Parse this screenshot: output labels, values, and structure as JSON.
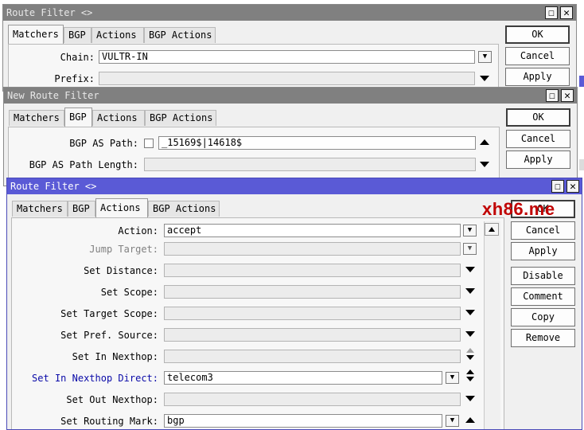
{
  "win1": {
    "title": "Route Filter <>",
    "tabs": [
      "Matchers",
      "BGP",
      "Actions",
      "BGP Actions"
    ],
    "chain_label": "Chain:",
    "chain_value": "VULTR-IN",
    "prefix_label": "Prefix:",
    "prefix_value": "",
    "buttons": {
      "ok": "OK",
      "cancel": "Cancel",
      "apply": "Apply"
    }
  },
  "win2": {
    "title": "New Route Filter",
    "tabs": [
      "Matchers",
      "BGP",
      "Actions",
      "BGP Actions"
    ],
    "as_path_label": "BGP AS Path:",
    "as_path_value": "_15169$|14618$",
    "as_path_length_label": "BGP AS Path Length:",
    "as_path_length_value": "",
    "buttons": {
      "ok": "OK",
      "cancel": "Cancel",
      "apply": "Apply"
    }
  },
  "win3": {
    "title": "Route Filter <>",
    "tabs": [
      "Matchers",
      "BGP",
      "Actions",
      "BGP Actions"
    ],
    "fields": {
      "action": {
        "label": "Action:",
        "value": "accept"
      },
      "jump_target": {
        "label": "Jump Target:",
        "value": ""
      },
      "set_distance": {
        "label": "Set Distance:",
        "value": ""
      },
      "set_scope": {
        "label": "Set Scope:",
        "value": ""
      },
      "set_target_scope": {
        "label": "Set Target Scope:",
        "value": ""
      },
      "set_pref_source": {
        "label": "Set Pref. Source:",
        "value": ""
      },
      "set_in_nexthop": {
        "label": "Set In Nexthop:",
        "value": ""
      },
      "set_in_nexthop_direct": {
        "label": "Set In Nexthop Direct:",
        "value": "telecom3"
      },
      "set_out_nexthop": {
        "label": "Set Out Nexthop:",
        "value": ""
      },
      "set_routing_mark": {
        "label": "Set Routing Mark:",
        "value": "bgp"
      }
    },
    "buttons": {
      "ok": "OK",
      "cancel": "Cancel",
      "apply": "Apply",
      "disable": "Disable",
      "comment": "Comment",
      "copy": "Copy",
      "remove": "Remove"
    }
  },
  "watermark": "xh86.me",
  "glyphs": {
    "close": "✕",
    "maximize": "☐",
    "dropdown": "▼"
  },
  "colors": {
    "active_title": "#5a5ad6",
    "inactive_title": "#808080",
    "watermark": "#c00000",
    "link_label": "#0a0aa8"
  }
}
